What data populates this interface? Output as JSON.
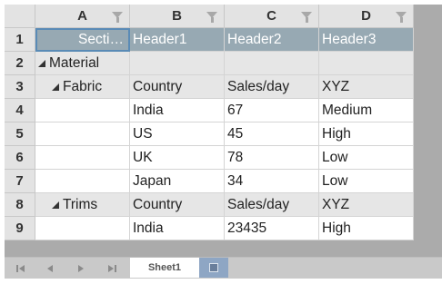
{
  "columns": [
    "A",
    "B",
    "C",
    "D"
  ],
  "rows": [
    {
      "num": "1",
      "cells": [
        "Secti…",
        "Header1",
        "Header2",
        "Header3"
      ]
    },
    {
      "num": "2",
      "cells": [
        "Material",
        "",
        "",
        ""
      ]
    },
    {
      "num": "3",
      "cells": [
        "Fabric",
        "Country",
        "Sales/day",
        "XYZ"
      ]
    },
    {
      "num": "4",
      "cells": [
        "",
        "India",
        "67",
        "Medium"
      ]
    },
    {
      "num": "5",
      "cells": [
        "",
        "US",
        "45",
        "High"
      ]
    },
    {
      "num": "6",
      "cells": [
        "",
        "UK",
        "78",
        "Low"
      ]
    },
    {
      "num": "7",
      "cells": [
        "",
        "Japan",
        "34",
        "Low"
      ]
    },
    {
      "num": "8",
      "cells": [
        "Trims",
        "Country",
        "Sales/day",
        "XYZ"
      ]
    },
    {
      "num": "9",
      "cells": [
        "",
        "India",
        "23435",
        "High"
      ]
    }
  ],
  "sheet_tabs": [
    "Sheet1"
  ],
  "icons": {
    "filter": "filter-icon",
    "expand": "collapse-triangle-icon",
    "nav": [
      "first-sheet-icon",
      "prev-sheet-icon",
      "next-sheet-icon",
      "last-sheet-icon"
    ],
    "add_sheet": "add-sheet-icon"
  },
  "colors": {
    "header_row": "#97a9b3",
    "section_row": "#e6e6e6",
    "selection": "#5a8bb6",
    "add_tab": "#8ea6c4"
  }
}
